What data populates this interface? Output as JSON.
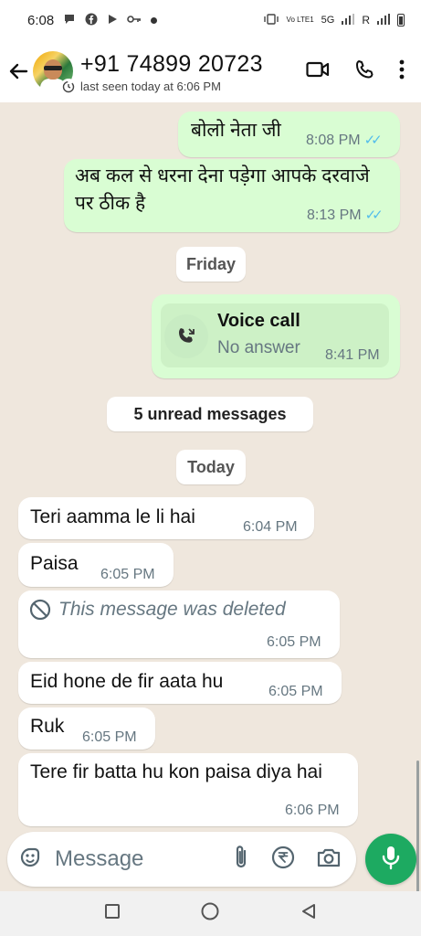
{
  "status_bar": {
    "time": "6:08",
    "network_label": "5G",
    "carrier_mark": "Vo LTE1",
    "roaming": "R",
    "icons": [
      "chat-bubble-icon",
      "facebook-icon",
      "play-icon",
      "key-icon",
      "dot-icon",
      "vibrate-icon",
      "signal-icon",
      "wifi-icon",
      "battery-icon"
    ]
  },
  "header": {
    "contact_name": "+91 74899 20723",
    "last_seen": "last seen today at 6:06 PM",
    "actions": [
      "video-call-icon",
      "voice-call-icon",
      "more-options-icon"
    ]
  },
  "messages": [
    {
      "direction": "out",
      "text": "बोलो नेता जी",
      "time": "8:08 PM",
      "ticks": "✓✓"
    },
    {
      "direction": "out",
      "text": "अब कल से धरना देना पड़ेगा आपके दरवाजे पर ठीक है",
      "time": "8:13 PM",
      "ticks": "✓✓"
    },
    {
      "type": "date",
      "label": "Friday"
    },
    {
      "direction": "out",
      "type": "call",
      "title": "Voice call",
      "subtitle": "No answer",
      "time": "8:41 PM"
    },
    {
      "type": "unread",
      "label": "5 unread messages"
    },
    {
      "type": "date",
      "label": "Today"
    },
    {
      "direction": "in",
      "text": "Teri aamma le li hai",
      "time": "6:04 PM"
    },
    {
      "direction": "in",
      "text": "Paisa",
      "time": "6:05 PM"
    },
    {
      "direction": "in",
      "type": "deleted",
      "text": "This message was deleted",
      "time": "6:05 PM"
    },
    {
      "direction": "in",
      "text": "Eid hone de fir aata hu",
      "time": "6:05 PM"
    },
    {
      "direction": "in",
      "text": "Ruk",
      "time": "6:05 PM"
    },
    {
      "direction": "in",
      "text": "Tere fir batta hu kon paisa diya hai",
      "time": "6:06 PM"
    }
  ],
  "composer": {
    "placeholder": "Message",
    "icons": [
      "sticker-icon",
      "attach-icon",
      "rupee-icon",
      "camera-icon",
      "mic-icon"
    ]
  },
  "colors": {
    "outgoing_bubble": "#d9fdd3",
    "incoming_bubble": "#ffffff",
    "chat_background": "#efe7dd",
    "read_ticks": "#53bdeb",
    "mic_button": "#1daa61"
  }
}
